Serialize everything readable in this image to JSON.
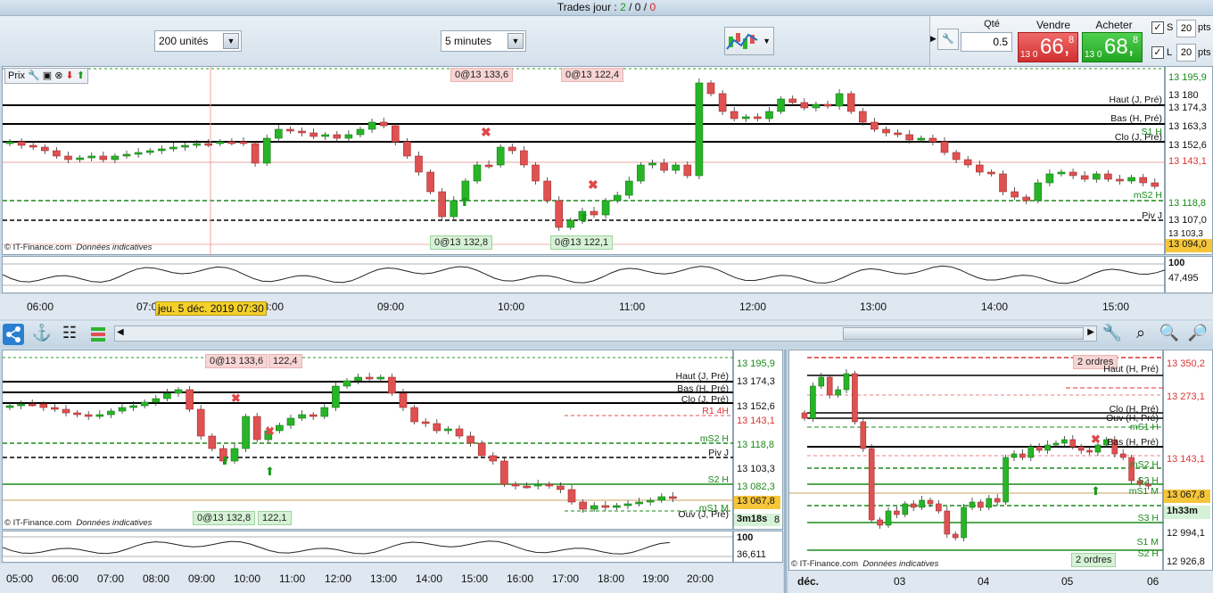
{
  "top": {
    "trades_label": "Trades jour : ",
    "t_green": "2",
    "t_sep1": " / ",
    "t_black": "0",
    "t_sep2": " / ",
    "t_red": "0"
  },
  "toolbar": {
    "units": "200 unités",
    "interval": "5 minutes"
  },
  "trade": {
    "qty_label": "Qté",
    "qty_value": "0.5",
    "sell_label": "Vendre",
    "buy_label": "Acheter",
    "sell_prefix": "13 0",
    "sell_big": "66,",
    "sell_sup": "8",
    "buy_prefix": "13 0",
    "buy_big": "68,",
    "buy_sup": "8",
    "s_label": "S",
    "s_value": "20",
    "s_unit": "pts",
    "l_label": "L",
    "l_value": "20",
    "l_unit": "pts"
  },
  "main_chart": {
    "panel_title": "Prix",
    "copyright": "© IT-Finance.com",
    "data_note": "Données indicatives",
    "orders_top": [
      "0@13 133,6",
      "0@13 122,4"
    ],
    "orders_bottom": [
      "0@13 132,8",
      "0@13 122,1"
    ],
    "line_labels": [
      "Haut (J, Pré)",
      "Bas (H, Pré)",
      "Clo (J, Pré)",
      "S1 H",
      "mS2 H",
      "Piv J"
    ],
    "prices": [
      "13 195,9",
      "13 180",
      "13 174,3",
      "13 163,3",
      "13 152,6",
      "13 143,1",
      "13 118,8",
      "13 107,0",
      "13 103,3",
      "13 094,0"
    ],
    "osc": [
      "100",
      "47,495"
    ],
    "time_labels": [
      "06:00",
      "07:00",
      "08:00",
      "09:00",
      "10:00",
      "11:00",
      "12:00",
      "13:00",
      "14:00",
      "15:00"
    ],
    "date_tooltip": "jeu. 5 déc. 2019 07:30"
  },
  "bl_chart": {
    "copyright": "© IT-Finance.com",
    "data_note": "Données indicatives",
    "orders_top": [
      "0@13 133,6",
      "122,4"
    ],
    "orders_bottom": [
      "0@13 132,8",
      "122,1"
    ],
    "line_labels": [
      "Haut (J, Pré)",
      "Bas (H, Pré)",
      "Clo (J, Pré)",
      "R1 4H",
      "mS2 H",
      "Piv J",
      "S2 H",
      "mS1 M",
      "Ouv (J, Pré)"
    ],
    "prices": [
      "13 195,9",
      "13 174,3",
      "13 152,6",
      "13 143,1",
      "13 118,8",
      "13 103,3",
      "13 082,3",
      "13 067,8",
      "8"
    ],
    "countdown": "3m18s",
    "osc": [
      "100",
      "36,611"
    ],
    "time_labels": [
      "05:00",
      "06:00",
      "07:00",
      "08:00",
      "09:00",
      "10:00",
      "11:00",
      "12:00",
      "13:00",
      "14:00",
      "15:00",
      "16:00",
      "17:00",
      "18:00",
      "19:00",
      "20:00"
    ]
  },
  "br_chart": {
    "copyright": "© IT-Finance.com",
    "data_note": "Données indicatives",
    "orders": [
      "2 ordres",
      "2 ordres"
    ],
    "line_labels": [
      "Haut (H, Pré)",
      "Clo (H, Pré)",
      "Ouv (H, Pré)",
      "mS1 H",
      "Bas (H, Pré)",
      "mS2 H",
      "S2 H",
      "mS1 M",
      "S3 H",
      "S1 M",
      "S2 H"
    ],
    "prices": [
      "13 350,2",
      "13 273,1",
      "13 143,1",
      "13 067,8",
      "12 994,1",
      "12 926,8"
    ],
    "countdown": "1h33m",
    "time_labels": [
      "déc.",
      "03",
      "04",
      "05",
      "06"
    ]
  },
  "colors": {
    "up": "#27b527",
    "down": "#e05151",
    "accent": "#2f7fd0"
  }
}
